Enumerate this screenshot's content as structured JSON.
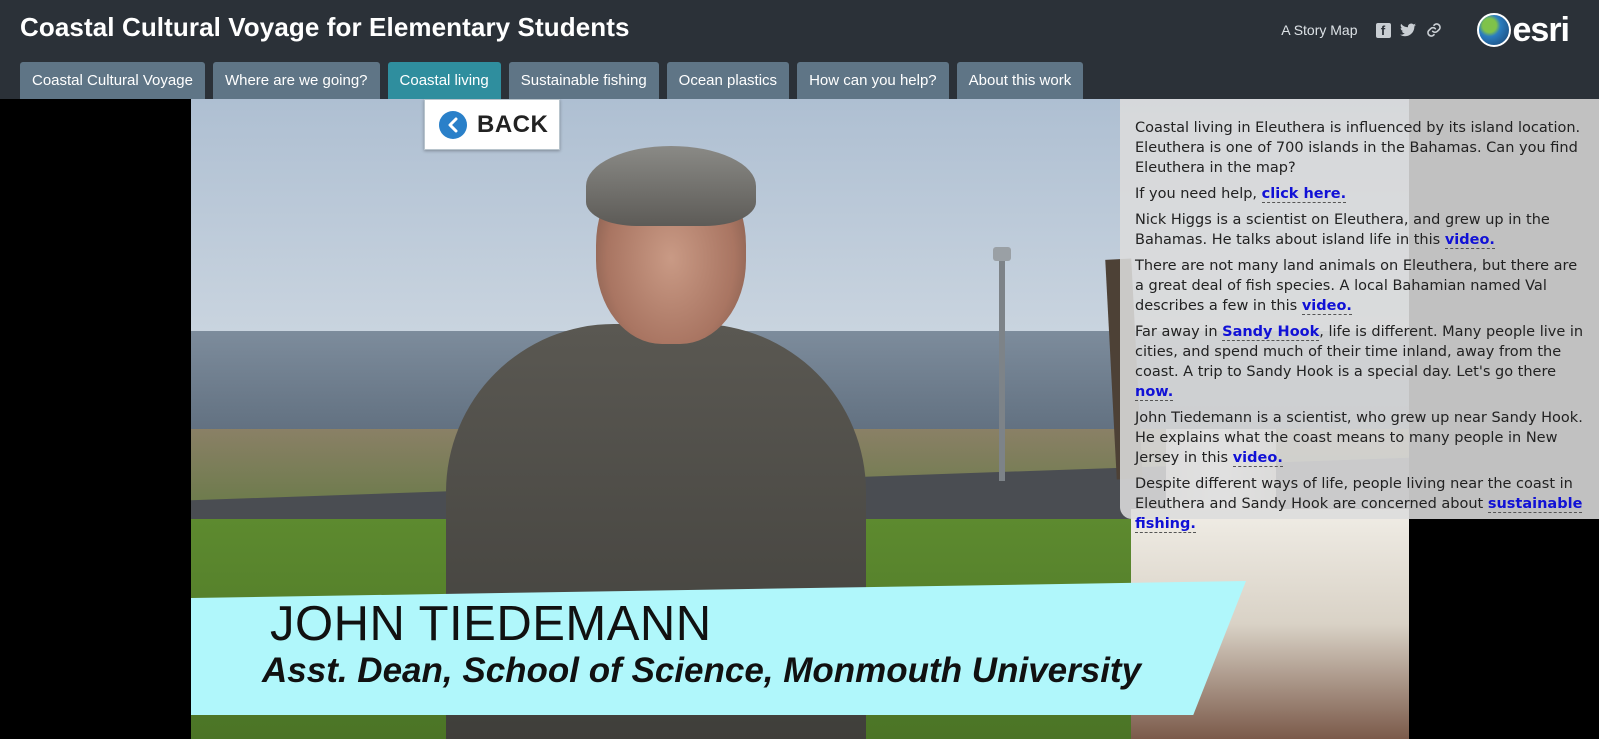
{
  "header": {
    "title": "Coastal Cultural Voyage for Elementary Students",
    "story_map_label": "A Story Map",
    "brand": "esri",
    "icons": [
      "facebook-icon",
      "twitter-icon",
      "link-icon"
    ]
  },
  "tabs": [
    {
      "label": "Coastal Cultural Voyage",
      "active": false
    },
    {
      "label": "Where are we going?",
      "active": false
    },
    {
      "label": "Coastal living",
      "active": true
    },
    {
      "label": "Sustainable fishing",
      "active": false
    },
    {
      "label": "Ocean plastics",
      "active": false
    },
    {
      "label": "How can you help?",
      "active": false
    },
    {
      "label": "About this work",
      "active": false
    }
  ],
  "back_button": {
    "label": "BACK"
  },
  "video_caption": {
    "name": "JOHN TIEDEMANN",
    "role": "Asst. Dean, School of Science, Monmouth University"
  },
  "panel": {
    "p1": "Coastal living in Eleuthera is influenced by its island location. Eleuthera is one of 700 islands in the Bahamas. Can you find Eleuthera in the map?",
    "p2_text": "If you need help, ",
    "p2_link": "click here.",
    "p3_text": "Nick Higgs is a scientist on Eleuthera, and grew up in the Bahamas. He talks about island life in this ",
    "p3_link": "video.",
    "p4_text": "There are not many land animals on Eleuthera, but there are a great deal of fish species. A local Bahamian named Val describes a few in this ",
    "p4_link": "video.",
    "p5_text_a": "Far away in ",
    "p5_link_a": "Sandy Hook",
    "p5_text_b": ", life is different. Many people live in cities, and spend much of their time inland, away from the coast. A trip to Sandy Hook is a special day. Let's go there ",
    "p5_link_b": "now.",
    "p6_text": "John Tiedemann is a scientist, who grew up near Sandy Hook. He explains what the coast means to many people in New Jersey in this ",
    "p6_link": "video.",
    "p7_text": "Despite different ways of life, people living near the coast in Eleuthera and Sandy Hook are concerned about ",
    "p7_link": "sustainable fishing."
  },
  "colors": {
    "header_bg": "#2b3138",
    "tab_bg": "#5f7586",
    "tab_active_bg": "#2f8e9e",
    "caption_bg": "#b0f7fb",
    "link": "#1111d6",
    "back_icon": "#2a80c9"
  }
}
